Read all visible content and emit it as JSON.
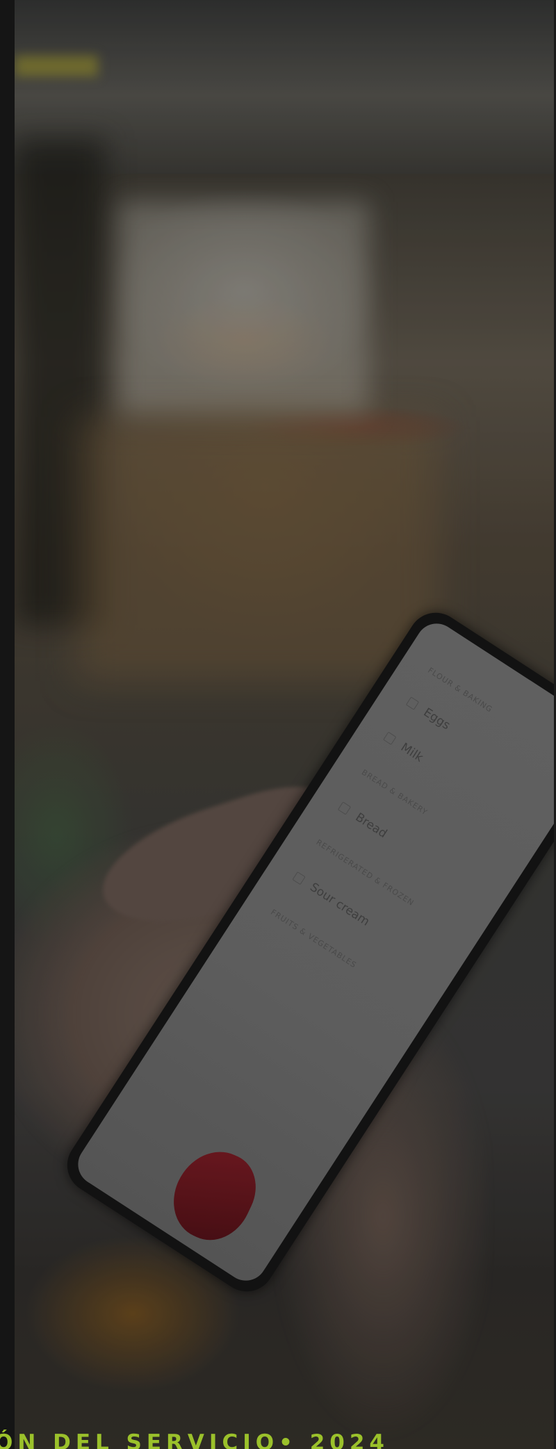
{
  "hero": {
    "image_alt": "woman holding smartphone with shopping list in supermarket",
    "phone_screen": {
      "rows": [
        {
          "type": "category",
          "label": "FLOUR & BAKING"
        },
        {
          "type": "item",
          "label": "Eggs"
        },
        {
          "type": "item",
          "label": "Milk"
        },
        {
          "type": "category",
          "label": "BREAD & BAKERY"
        },
        {
          "type": "item",
          "label": "Bread"
        },
        {
          "type": "category",
          "label": "REFRIGERATED & FROZEN"
        },
        {
          "type": "item",
          "label": "Sour cream"
        },
        {
          "type": "category",
          "label": "FRUITS & VEGETABLES"
        }
      ]
    }
  },
  "caption": {
    "text": "ÓN DEL SERVICIO• 2024"
  },
  "colors": {
    "accent": "#9bc12b",
    "background": "#141414"
  }
}
